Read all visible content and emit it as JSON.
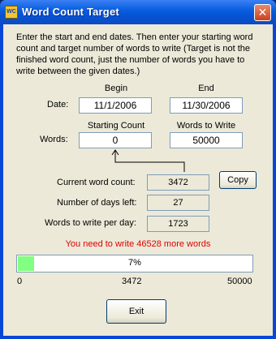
{
  "window": {
    "title": "Word Count Target",
    "app_icon": "WC"
  },
  "intro": "Enter the start and end dates. Then enter your starting word count and target number of words to write (Target is not the finished word count, just the number of words you have to write between the given dates.)",
  "dates": {
    "label": "Date:",
    "begin_label": "Begin",
    "end_label": "End",
    "begin": "11/1/2006",
    "end": "11/30/2006"
  },
  "words": {
    "label": "Words:",
    "start_label": "Starting Count",
    "target_label": "Words to Write",
    "start": "0",
    "target": "50000"
  },
  "stats": {
    "current_label": "Current word count:",
    "current": "3472",
    "days_label": "Number of days left:",
    "days": "27",
    "perday_label": "Words to write per day:",
    "perday": "1723"
  },
  "copy_button": "Copy",
  "message": "You need to write 46528 more words",
  "progress": {
    "value": 0.07,
    "label": "7%",
    "min": "0",
    "mid": "3472",
    "max": "50000",
    "fill_color": "#80ff80"
  },
  "exit_button": "Exit",
  "colors": {
    "message": "#e00000",
    "titlebar": "#0a5fe0"
  }
}
